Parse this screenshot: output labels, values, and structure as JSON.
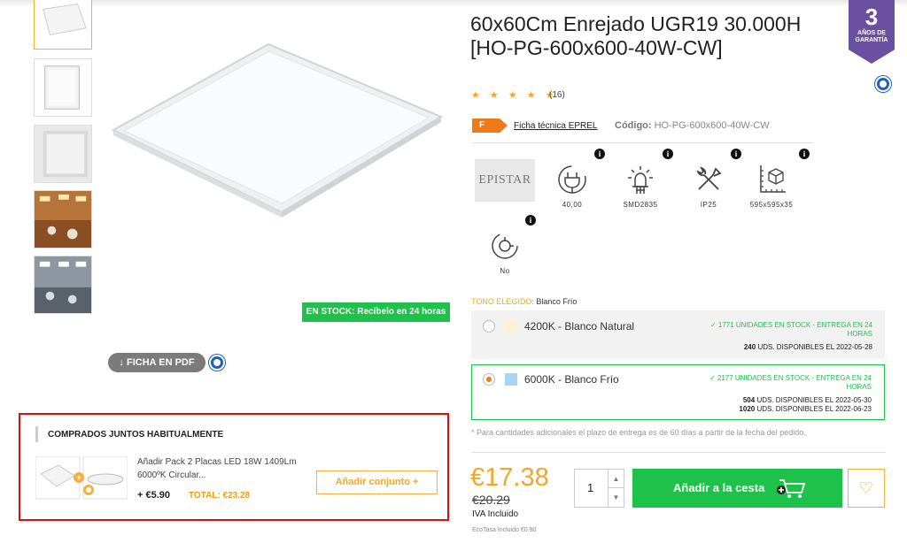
{
  "product": {
    "title": "60x60Cm Enrejado UGR19 30.000H [HO-PG-600x600-40W-CW]",
    "rating_stars": "★ ★ ★ ★ ★",
    "rating_value": 5,
    "reviews": "(16)",
    "stock_badge": "EN STOCK: Recíbelo en 24 horas",
    "pdf_button": "↓ FICHA EN PDF",
    "warranty": {
      "number": "3",
      "line1": "AÑOS DE",
      "line2": "GARANTÍA"
    }
  },
  "eprel": {
    "energy_class": "F",
    "link": "Ficha técnica EPREL",
    "code_label": "Código:",
    "code_value": "HO-PG-600x600-40W-CW",
    "energy_color": "#f07a1a"
  },
  "specs": [
    {
      "icon": "epistar-logo",
      "value": "EPISTAR"
    },
    {
      "icon": "plug-icon",
      "value": "40,00"
    },
    {
      "icon": "led-chip-icon",
      "value": "SMD2835"
    },
    {
      "icon": "tools-icon",
      "value": "IP25"
    },
    {
      "icon": "dimensions-icon",
      "value": "595x595x35"
    },
    {
      "icon": "dimmer-icon",
      "value": "No"
    }
  ],
  "tone": {
    "label": "TONO ELEGIDO:",
    "selected": "Blanco Frío",
    "options": [
      {
        "name": "4200K - Blanco Natural",
        "swatch": "#fbf3d0",
        "selected": false,
        "stock_line1": "✓ 1771 UNIDADES EN STOCK - ENTREGA EN 24",
        "stock_line2": "HORAS",
        "avail": [
          {
            "qty": "240",
            "text": "UDS. DISPONIBLES EL 2022-05-28"
          }
        ]
      },
      {
        "name": "6000K - Blanco Frío",
        "swatch": "#a8d4f5",
        "selected": true,
        "stock_line1": "✓ 2177 UNIDADES EN STOCK - ENTREGA EN 24",
        "stock_line2": "HORAS",
        "avail": [
          {
            "qty": "504",
            "text": "UDS. DISPONIBLES EL 2022-05-30"
          },
          {
            "qty": "1020",
            "text": "UDS. DISPONIBLES EL 2022-06-23"
          }
        ]
      }
    ],
    "note": "* Para cantidades adicionales el plazo de entrega es de 60 días a partir de la fecha del pedido."
  },
  "pricing": {
    "price": "€17.38",
    "old_price": "€20.29",
    "iva": "IVA Incluido",
    "ecotasa": "EcoTasa Incluido €0.90",
    "quantity": "1",
    "add_to_cart": "Añadir a la cesta",
    "accent_color": "#f5a623",
    "cta_color": "#1ec24b"
  },
  "bought_together": {
    "title": "COMPRADOS JUNTOS HABITUALMENTE",
    "description_line1": "Añadir Pack 2 Placas LED 18W 1409Lm",
    "description_line2": "6000ºK Circular...",
    "price": "+ €5.90",
    "total": "TOTAL: €23.28",
    "button": "Añadir conjunto  +"
  }
}
